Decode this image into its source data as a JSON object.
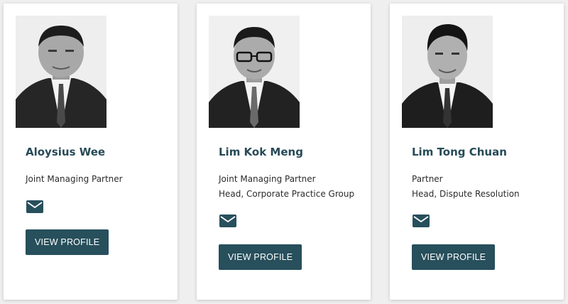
{
  "people": [
    {
      "name": "Aloysius Wee",
      "roles": [
        "Joint Managing Partner"
      ],
      "photo_alt": "portrait photo",
      "email_icon": "envelope-icon",
      "button_label": "VIEW PROFILE"
    },
    {
      "name": "Lim Kok Meng",
      "roles": [
        "Joint Managing Partner",
        "Head, Corporate Practice Group"
      ],
      "photo_alt": "portrait photo",
      "email_icon": "envelope-icon",
      "button_label": "VIEW PROFILE"
    },
    {
      "name": "Lim Tong Chuan",
      "roles": [
        "Partner",
        "Head, Dispute Resolution"
      ],
      "photo_alt": "portrait photo",
      "email_icon": "envelope-icon",
      "button_label": "VIEW PROFILE"
    }
  ],
  "colors": {
    "accent": "#274f5c",
    "name_text": "#274a57",
    "card_bg": "#ffffff",
    "page_bg": "#efefef"
  }
}
